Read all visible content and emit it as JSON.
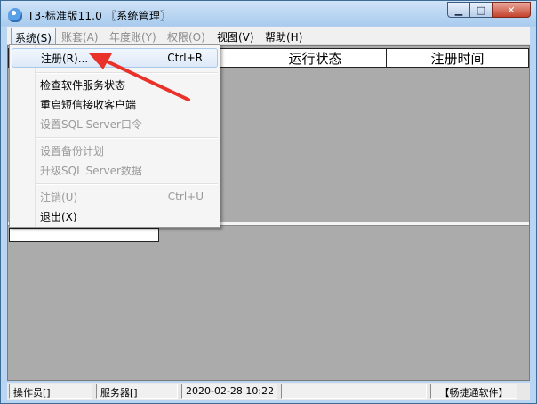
{
  "window": {
    "title": "T3-标准版11.0 〖系统管理〗",
    "minimize_icon": "minimize-icon",
    "maximize_icon": "maximize-icon",
    "close_icon": "close-icon",
    "close_color": "#c4422b"
  },
  "menubar": {
    "items": [
      {
        "label": "系统(S)",
        "enabled": true
      },
      {
        "label": "账套(A)",
        "enabled": false
      },
      {
        "label": "年度账(Y)",
        "enabled": false
      },
      {
        "label": "权限(O)",
        "enabled": false
      },
      {
        "label": "视图(V)",
        "enabled": true
      },
      {
        "label": "帮助(H)",
        "enabled": true
      }
    ]
  },
  "system_menu": {
    "items": [
      {
        "label": "注册(R)...",
        "shortcut": "Ctrl+R",
        "enabled": true,
        "highlighted": true
      },
      {
        "label": "检查软件服务状态",
        "shortcut": "",
        "enabled": true
      },
      {
        "label": "重启短信接收客户端",
        "shortcut": "",
        "enabled": true
      },
      {
        "label": "设置SQL Server口令",
        "shortcut": "",
        "enabled": false
      },
      {
        "label": "设置备份计划",
        "shortcut": "",
        "enabled": false
      },
      {
        "label": "升级SQL Server数据",
        "shortcut": "",
        "enabled": false
      },
      {
        "label": "注销(U)",
        "shortcut": "Ctrl+U",
        "enabled": false
      },
      {
        "label": "退出(X)",
        "shortcut": "",
        "enabled": true
      }
    ]
  },
  "main_table": {
    "columns": [
      "",
      "运行状态",
      "注册时间"
    ]
  },
  "statusbar": {
    "operator": "操作员[]",
    "server": "服务器[]",
    "datetime": "2020-02-28 10:22",
    "company": "【畅捷通软件】"
  },
  "annotation": {
    "arrow_color": "#e8322a"
  }
}
